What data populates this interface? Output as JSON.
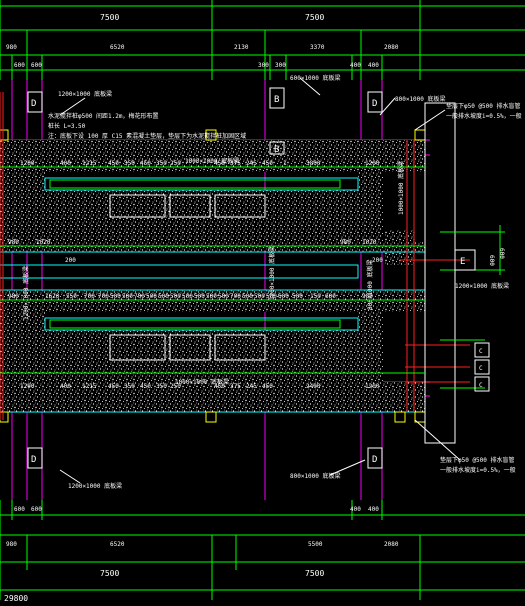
{
  "colors": {
    "background": "#000000",
    "dimension_lines": "#00ff00",
    "grid_lines": "#cc00cc",
    "walls": "#00ffff",
    "slab_texture": "#ffffff",
    "callout_lines": "#ffffff",
    "red_lines": "#ff2020",
    "columns": "#ffff00"
  },
  "top_dimensions": {
    "row1": [
      "7500",
      "7500"
    ],
    "row2": [
      "980",
      "6520",
      "2130",
      "3370",
      "2080"
    ],
    "row3": [
      "600",
      "600",
      "300",
      "300",
      "400",
      "400"
    ]
  },
  "bottom_dimensions": {
    "row1": [
      "600",
      "600",
      "400",
      "400"
    ],
    "row2": [
      "980",
      "6520",
      "5500",
      "2080"
    ],
    "row3": [
      "7500",
      "7500"
    ],
    "total": "29800"
  },
  "beam_labels": {
    "top_left": "1200×1000 底板梁",
    "top_mid": "600×1000 底板梁",
    "top_right": "800×1000 底板梁",
    "upper_inner": "1000×1000 底板梁",
    "mid_inner": "1000×1000 底板梁",
    "left_vertical": "1200×1000 底板梁",
    "center_vertical": "1200×1000 底板梁",
    "right_vertical_upper": "1000×1000 底板梁",
    "right_vertical_mid": "800×1000 底板梁",
    "right_small": "1200×1000 底板梁",
    "bottom_left": "1200×1000 底板梁",
    "bottom_right": "800×1000 底板梁"
  },
  "notes": {
    "left_1": "水泥搅拌桩φ500 间距1.2m，梅花形布置",
    "left_2": "桩长 L=3.50",
    "left_3": "注：底板下设 100 厚 C15 素混凝土垫层，垫层下为水泥搅拌桩加固区域",
    "right_top_1": "垫层下φ50 @500 排水盲管",
    "right_top_2": "一般排水坡度i=0.5%，一般",
    "right_bot_1": "垫层下φ50 @500 排水盲管",
    "right_bot_2": "一般排水坡度i=0.5%，一般"
  },
  "axis_labels": {
    "d1": "D",
    "d2": "D",
    "d3": "D",
    "d4": "D",
    "b1": "B",
    "b2": "B",
    "e": "E",
    "c1": "C",
    "c2": "C",
    "c3": "C"
  },
  "upper_room_dims": [
    "1200",
    "400",
    "1215",
    "450",
    "350",
    "450",
    "350",
    "250",
    "450",
    "375",
    "245",
    "450",
    "1",
    "3800",
    "1200"
  ],
  "upper_room_bottom_dims": [
    "980",
    "1020",
    "980",
    "1020"
  ],
  "corridor": {
    "dim_left": "200",
    "dim_right": "200"
  },
  "lower_room_top_dims": [
    "980",
    "1620",
    "550",
    "700",
    "700",
    "500",
    "500",
    "700",
    "500",
    "500",
    "500",
    "500",
    "500",
    "500",
    "500",
    "700",
    "500",
    "500",
    "500",
    "600",
    "500",
    "150",
    "600",
    "980"
  ],
  "lower_room_dims": [
    "1200",
    "400",
    "1215",
    "450",
    "350",
    "450",
    "350",
    "250",
    "450",
    "375",
    "245",
    "450",
    "2400",
    "1200"
  ],
  "right_box": {
    "dim_1": "600",
    "dim_2": "600"
  }
}
